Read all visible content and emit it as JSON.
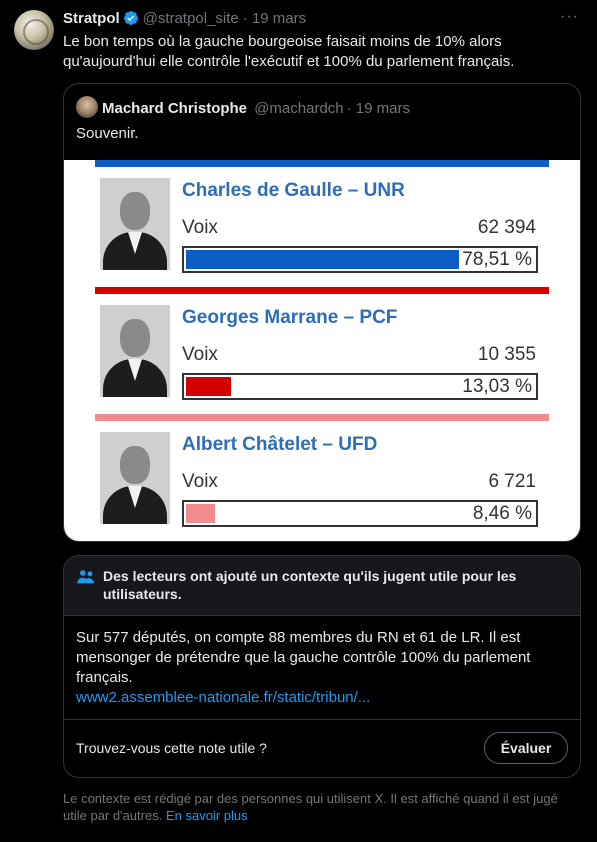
{
  "tweet": {
    "author_name": "Stratpol",
    "handle": "@stratpol_site",
    "date": "· 19 mars",
    "more_label": "···",
    "text": "Le bon temps où la gauche bourgeoise faisait moins de 10% alors qu'aujourd'hui elle contrôle l'exécutif et 100% du parlement français."
  },
  "quote": {
    "author_name": "Machard Christophe",
    "handle": "@machardch",
    "date": "· 19 mars",
    "text": "Souvenir."
  },
  "chart_data": {
    "type": "bar",
    "categories": [
      "Charles de Gaulle – UNR",
      "Georges Marrane – PCF",
      "Albert Châtelet – UFD"
    ],
    "series": [
      {
        "values": [
          78.51,
          13.03,
          8.46
        ]
      }
    ],
    "ylim": [
      0,
      100
    ]
  },
  "candidates": [
    {
      "name": "Charles de Gaulle – UNR",
      "voix_label": "Voix",
      "voix": "62 394",
      "pct_label": "78,51 %",
      "pct": 78.51,
      "color": "#0b5cc5"
    },
    {
      "name": "Georges Marrane – PCF",
      "voix_label": "Voix",
      "voix": "10 355",
      "pct_label": "13,03 %",
      "pct": 13.03,
      "color": "#d40000"
    },
    {
      "name": "Albert Châtelet – UFD",
      "voix_label": "Voix",
      "voix": "6 721",
      "pct_label": "8,46 %",
      "pct": 8.46,
      "color": "#f28b8b"
    }
  ],
  "note": {
    "title": "Des lecteurs ont ajouté un contexte qu'ils jugent utile pour les utilisateurs.",
    "body": "Sur 577 députés, on compte 88 membres du RN et 61 de LR. Il est mensonger de prétendre que la gauche contrôle 100% du parlement français.",
    "link": "www2.assemblee-nationale.fr/static/tribun/...",
    "helpful_question": "Trouvez-vous cette note utile ?",
    "rate_button": "Évaluer"
  },
  "footer": {
    "text": "Le contexte est rédigé par des personnes qui utilisent X. Il est affiché quand il est jugé utile par d'autres.",
    "learn_more": "En savoir plus"
  },
  "colors": {
    "accent": "#1d9bf0",
    "muted": "#71767b",
    "border": "#2f3336",
    "candidate_name": "#2e6db8"
  }
}
